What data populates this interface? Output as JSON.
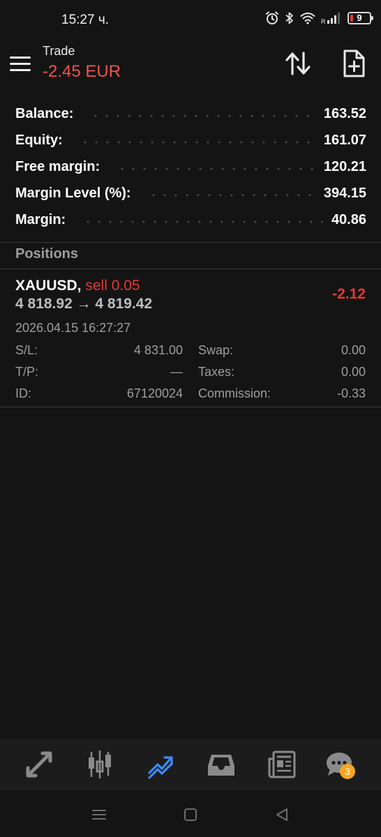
{
  "status_bar": {
    "time": "15:27 ч.",
    "battery_level": "9",
    "network_label": "R"
  },
  "header": {
    "title": "Trade",
    "profit": "-2.45 EUR"
  },
  "summary": [
    {
      "label": "Balance:",
      "value": "163.52"
    },
    {
      "label": "Equity:",
      "value": "161.07"
    },
    {
      "label": "Free margin:",
      "value": "120.21"
    },
    {
      "label": "Margin Level (%):",
      "value": "394.15"
    },
    {
      "label": "Margin:",
      "value": "40.86"
    }
  ],
  "positions_title": "Positions",
  "position": {
    "symbol": "XAUUSD,",
    "type": "sell 0.05",
    "prices": "4 818.92 → 4 819.42",
    "profit": "-2.12",
    "time": "2026.04.15 16:27:27",
    "details": {
      "sl_label": "S/L:",
      "sl_value": "4 831.00",
      "tp_label": "T/P:",
      "tp_value": "—",
      "id_label": "ID:",
      "id_value": "67120024",
      "swap_label": "Swap:",
      "swap_value": "0.00",
      "taxes_label": "Taxes:",
      "taxes_value": "0.00",
      "commission_label": "Commission:",
      "commission_value": "-0.33"
    }
  },
  "bottom_nav": {
    "items": [
      "quotes",
      "chart",
      "trade",
      "history",
      "news",
      "messages"
    ],
    "active": "trade",
    "messages_badge": "3"
  },
  "colors": {
    "background": "#141414",
    "loss": "#e53935",
    "accent": "#3d8bf2",
    "muted": "#9e9e9e",
    "badge": "#f5a623"
  }
}
